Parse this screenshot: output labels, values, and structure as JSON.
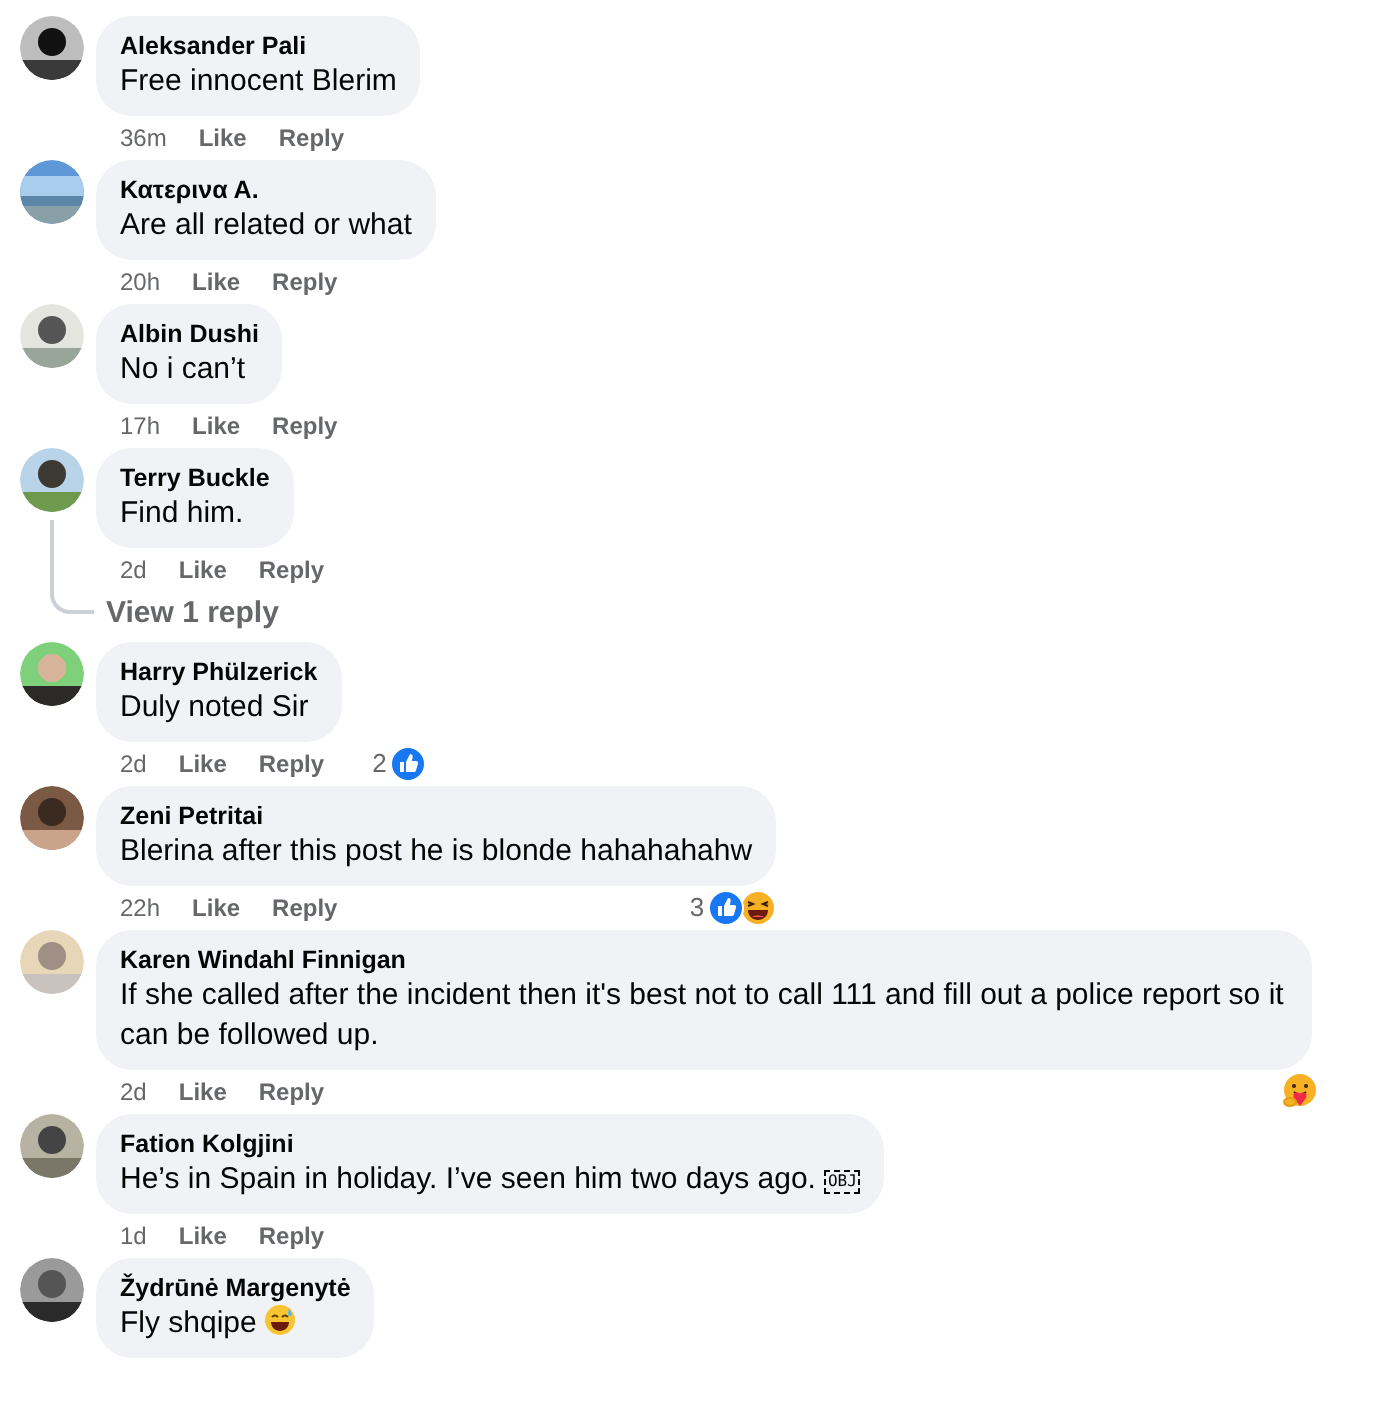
{
  "comments": [
    {
      "author": "Aleksander Pali",
      "text": "Free innocent Blerim",
      "time": "36m",
      "like": "Like",
      "reply": "Reply"
    },
    {
      "author": "Κατερινα Α.",
      "text": "Are all related or what",
      "time": "20h",
      "like": "Like",
      "reply": "Reply"
    },
    {
      "author": "Albin Dushi",
      "text": "No i can’t",
      "time": "17h",
      "like": "Like",
      "reply": "Reply"
    },
    {
      "author": "Terry Buckle",
      "text": "Find him.",
      "time": "2d",
      "like": "Like",
      "reply": "Reply",
      "replies_link": "View 1 reply"
    },
    {
      "author": "Harry Phülzerick",
      "text": "Duly noted Sir",
      "time": "2d",
      "like": "Like",
      "reply": "Reply",
      "reactions": {
        "count": "2",
        "icons": [
          {
            "kind": "like"
          }
        ]
      }
    },
    {
      "author": "Zeni Petritai",
      "text": "Blerina after this post he is blonde hahahahahw",
      "time": "22h",
      "like": "Like",
      "reply": "Reply",
      "reactions": {
        "count": "3",
        "icons": [
          {
            "kind": "like"
          },
          {
            "kind": "haha"
          }
        ]
      }
    },
    {
      "author": "Karen Windahl Finnigan",
      "text": "If she called after the incident then it's best not to call 111 and fill out a police report so it can be followed up.",
      "time": "2d",
      "like": "Like",
      "reply": "Reply",
      "reactions": {
        "icons": [
          {
            "kind": "care"
          }
        ]
      }
    },
    {
      "author": "Fation Kolgjini",
      "text": "He’s in Spain in holiday. I’ve seen him two days ago.",
      "object_placeholder": "OBJ",
      "time": "1d",
      "like": "Like",
      "reply": "Reply"
    },
    {
      "author": "Žydrūnė Margenytė",
      "text": "Fly shqipe",
      "emoji": {
        "kind": "sweat-smile"
      }
    }
  ]
}
